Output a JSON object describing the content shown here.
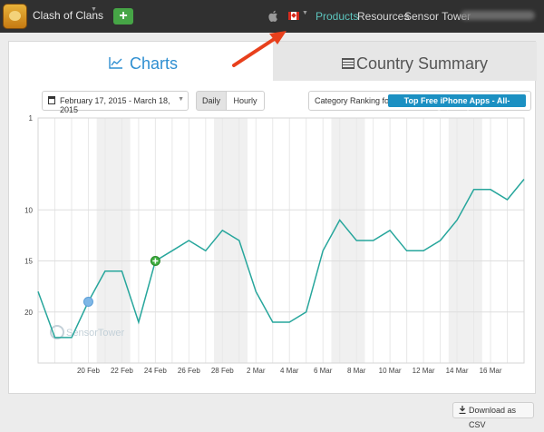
{
  "topbar": {
    "app_name": "Clash of Clans",
    "add_label": "+",
    "nav": [
      "Products",
      "Resources",
      "Sensor Tower"
    ],
    "active_nav": "Products"
  },
  "tabs": {
    "charts_label": "Charts",
    "country_label": "Country Summary",
    "active": "Charts"
  },
  "controls": {
    "date_range": "February 17, 2015 - March 18, 2015",
    "daily_label": "Daily",
    "hourly_label": "Hourly",
    "active_granularity": "Daily",
    "category_label": "Category Ranking for:",
    "category_value": "Top Free iPhone Apps - All-Categories"
  },
  "export": {
    "csv_label": "Download as CSV"
  },
  "watermark": "SensorTower",
  "colors": {
    "accent": "#2f8fd1",
    "nav_active": "#5cc4bd",
    "line": "#27a69c",
    "badge": "#1b90c2",
    "add_button": "#46a546",
    "annotation_arrow": "#e8401c"
  },
  "icons": [
    "apple-icon",
    "canada-flag-icon",
    "chart-line-icon",
    "table-icon",
    "download-icon",
    "calendar-icon"
  ],
  "chart_data": {
    "type": "line",
    "title": "",
    "xlabel": "",
    "ylabel": "",
    "y_inverted": true,
    "ylim": [
      1,
      25
    ],
    "ytick_labels": [
      "1",
      "10",
      "15",
      "20"
    ],
    "xtick_labels": [
      "20 Feb",
      "22 Feb",
      "24 Feb",
      "26 Feb",
      "28 Feb",
      "2 Mar",
      "4 Mar",
      "6 Mar",
      "8 Mar",
      "10 Mar",
      "12 Mar",
      "14 Mar",
      "16 Mar"
    ],
    "x": [
      "Feb 17",
      "Feb 18",
      "Feb 19",
      "Feb 20",
      "Feb 21",
      "Feb 22",
      "Feb 23",
      "Feb 24",
      "Feb 25",
      "Feb 26",
      "Feb 27",
      "Feb 28",
      "Mar 1",
      "Mar 2",
      "Mar 3",
      "Mar 4",
      "Mar 5",
      "Mar 6",
      "Mar 7",
      "Mar 8",
      "Mar 9",
      "Mar 10",
      "Mar 11",
      "Mar 12",
      "Mar 13",
      "Mar 14",
      "Mar 15",
      "Mar 16",
      "Mar 17",
      "Mar 18"
    ],
    "series": [
      {
        "values": [
          18,
          22.5,
          22.5,
          19,
          16,
          16,
          21,
          15,
          14,
          13,
          14,
          12,
          13,
          18,
          21,
          21,
          20,
          14,
          11,
          13,
          13,
          12,
          14,
          14,
          13,
          11,
          8,
          8,
          9,
          7
        ]
      }
    ],
    "markers": [
      {
        "x": "Feb 20",
        "y": 19,
        "kind": "blue-dot"
      },
      {
        "x": "Feb 24",
        "y": 15,
        "kind": "green-plus"
      }
    ],
    "grid": true,
    "shaded_weekends": true
  }
}
